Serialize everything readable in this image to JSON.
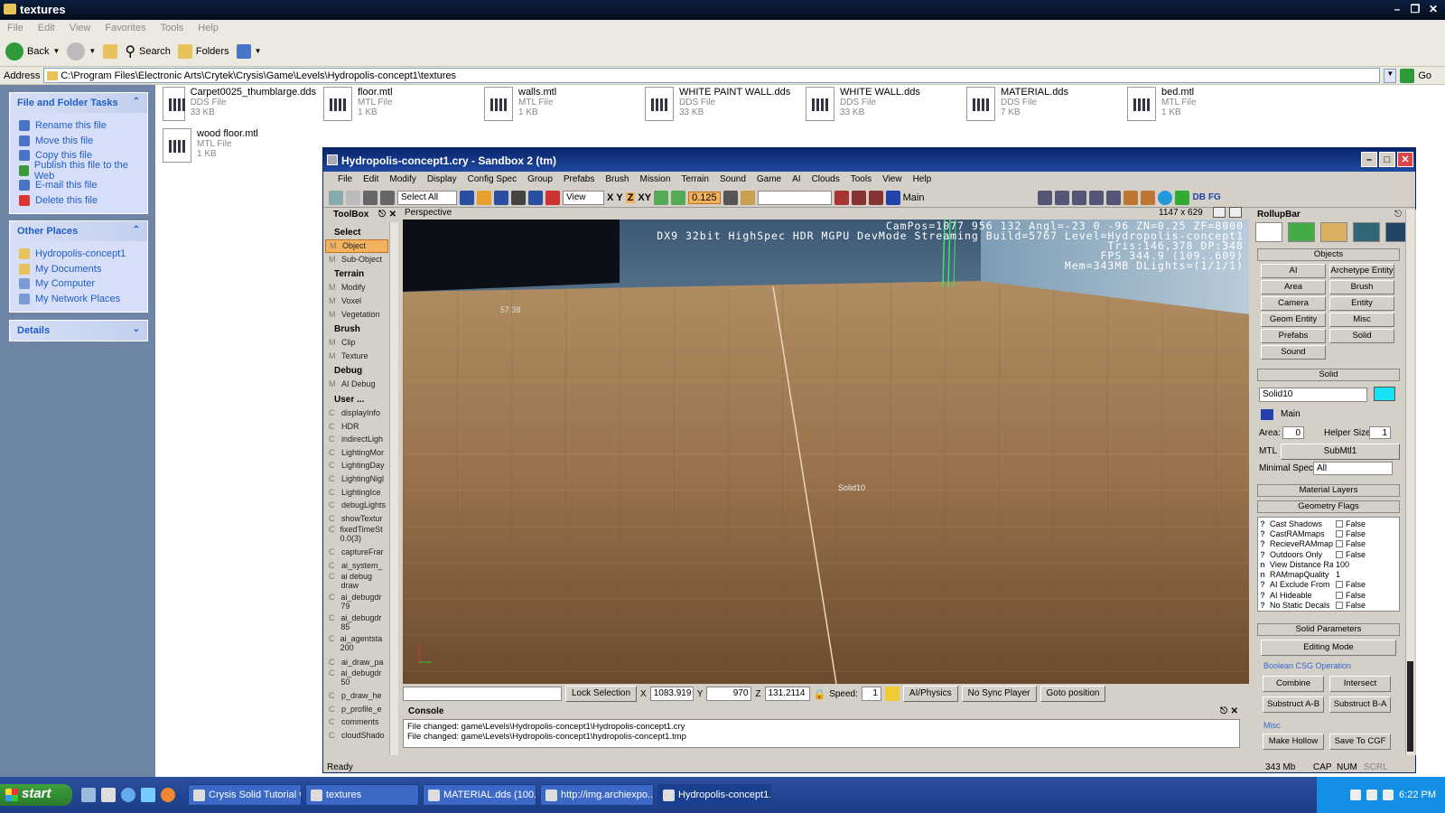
{
  "explorer": {
    "title": "textures",
    "menu": [
      "File",
      "Edit",
      "View",
      "Favorites",
      "Tools",
      "Help"
    ],
    "toolbar": {
      "back": "Back",
      "search": "Search",
      "folders": "Folders"
    },
    "address_label": "Address",
    "address": "C:\\Program Files\\Electronic Arts\\Crytek\\Crysis\\Game\\Levels\\Hydropolis-concept1\\textures",
    "go": "Go",
    "tasks_title": "File and Folder Tasks",
    "tasks": [
      "Rename this file",
      "Move this file",
      "Copy this file",
      "Publish this file to the Web",
      "E-mail this file",
      "Delete this file"
    ],
    "places_title": "Other Places",
    "places": [
      "Hydropolis-concept1",
      "My Documents",
      "My Computer",
      "My Network Places"
    ],
    "details_title": "Details",
    "files": [
      {
        "name": "Carpet0025_thumblarge.dds",
        "type": "DDS File",
        "size": "33 KB"
      },
      {
        "name": "floor.mtl",
        "type": "MTL File",
        "size": "1 KB"
      },
      {
        "name": "walls.mtl",
        "type": "MTL File",
        "size": "1 KB"
      },
      {
        "name": "WHITE PAINT WALL.dds",
        "type": "DDS File",
        "size": "33 KB"
      },
      {
        "name": "WHITE WALL.dds",
        "type": "DDS File",
        "size": "33 KB"
      },
      {
        "name": "MATERIAL.dds",
        "type": "DDS File",
        "size": "7 KB"
      },
      {
        "name": "bed.mtl",
        "type": "MTL File",
        "size": "1 KB"
      },
      {
        "name": "wood floor.mtl",
        "type": "MTL File",
        "size": "1 KB"
      }
    ]
  },
  "sandbox": {
    "title": "Hydropolis-concept1.cry - Sandbox 2 (tm)",
    "menu": [
      "File",
      "Edit",
      "Modify",
      "Display",
      "Config Spec",
      "Group",
      "Prefabs",
      "Brush",
      "Mission",
      "Terrain",
      "Sound",
      "Game",
      "AI",
      "Clouds",
      "Tools",
      "View",
      "Help"
    ],
    "toolbar": {
      "select_all": "Select All",
      "view": "View",
      "grid": "0.125",
      "layer": "Main",
      "axis_x": "X",
      "axis_y": "Y",
      "axis_z": "Z",
      "axis_xy": "XY",
      "db": "DB",
      "fg": "FG"
    },
    "toolbox": {
      "title": "ToolBox",
      "sections": [
        {
          "name": "Select",
          "items": [
            {
              "p": "M",
              "label": "Object",
              "sel": true
            },
            {
              "p": "M",
              "label": "Sub-Object"
            }
          ]
        },
        {
          "name": "Terrain",
          "items": [
            {
              "p": "M",
              "label": "Modify"
            },
            {
              "p": "M",
              "label": "Voxel"
            },
            {
              "p": "M",
              "label": "Vegetation"
            }
          ]
        },
        {
          "name": "Brush",
          "items": [
            {
              "p": "M",
              "label": "Clip"
            },
            {
              "p": "M",
              "label": "Texture"
            }
          ]
        },
        {
          "name": "Debug",
          "items": [
            {
              "p": "M",
              "label": "AI Debug"
            }
          ]
        },
        {
          "name": "User ...",
          "items": [
            {
              "p": "C",
              "label": "displayInfo"
            },
            {
              "p": "C",
              "label": "HDR"
            },
            {
              "p": "C",
              "label": "indirectLigh"
            },
            {
              "p": "C",
              "label": "LightingMor"
            },
            {
              "p": "C",
              "label": "LightingDay"
            },
            {
              "p": "C",
              "label": "LightingNigl"
            },
            {
              "p": "C",
              "label": "LightingIce"
            },
            {
              "p": "C",
              "label": "debugLights"
            },
            {
              "p": "C",
              "label": "showTextur"
            },
            {
              "p": "C",
              "label": "fixedTimeSt 0.0(3)"
            },
            {
              "p": "C",
              "label": "captureFrar"
            },
            {
              "p": "C",
              "label": "ai_system_"
            },
            {
              "p": "C",
              "label": "ai debug draw"
            },
            {
              "p": "C",
              "label": "ai_debugdr 79"
            },
            {
              "p": "C",
              "label": "ai_debugdr 85"
            },
            {
              "p": "C",
              "label": "ai_agentsta 200"
            },
            {
              "p": "C",
              "label": "ai_draw_pa"
            },
            {
              "p": "C",
              "label": "ai_debugdr 50"
            },
            {
              "p": "C",
              "label": "p_draw_he"
            },
            {
              "p": "C",
              "label": "p_profile_e"
            },
            {
              "p": "C",
              "label": "comments"
            },
            {
              "p": "C",
              "label": "cloudShado"
            }
          ]
        }
      ]
    },
    "viewport": {
      "label": "Perspective",
      "size": "1147 x 629",
      "hud": [
        "CamPos=1077 956 132 Angl=-23  0 -96 ZN=0.25 ZF=8000",
        "DX9 32bit HighSpec HDR MGPU DevMode Streaming Build=5767 Level=Hydropolis-concept1",
        "Tris:146,378  DP:348",
        "FPS 344.9 (109..609)",
        "Mem=343MB DLights=(1/1/1)"
      ],
      "marker": "57.38",
      "object_label": "Solid10"
    },
    "status": {
      "lock": "Lock Selection",
      "x_label": "X",
      "x": "1083.919",
      "y_label": "Y",
      "y": "970",
      "z_label": "Z",
      "z": "131.2114",
      "speed_label": "Speed:",
      "speed": "1",
      "ai_physics": "AI/Physics",
      "no_sync": "No Sync Player",
      "goto": "Goto position"
    },
    "console": {
      "title": "Console",
      "lines": [
        "File changed: game\\Levels\\Hydropolis-concept1\\Hydropolis-concept1.cry",
        "File changed: game\\Levels\\Hydropolis-concept1\\hydropolis-concept1.tmp"
      ]
    },
    "statusbar": {
      "ready": "Ready",
      "mem": "343 Mb",
      "cap": "CAP",
      "num": "NUM",
      "scrl": "SCRL"
    },
    "rollup": {
      "title": "RollupBar",
      "objects_head": "Objects",
      "objects": [
        "AI",
        "Archetype Entity",
        "Area",
        "Brush",
        "Camera",
        "Entity",
        "Geom Entity",
        "Misc",
        "Prefabs",
        "Solid",
        "Sound"
      ],
      "solid_head": "Solid",
      "name": "Solid10",
      "color": "#19e0f2",
      "layer": "Main",
      "area_label": "Area:",
      "area": "0",
      "helper_label": "Helper Size:",
      "helper": "1",
      "mtl_label": "MTL",
      "mtl": "SubMtl1",
      "minspec_label": "Minimal Spec:",
      "minspec": "All",
      "material_layers": "Material Layers",
      "geometry_flags": "Geometry Flags",
      "flags": [
        {
          "q": "?",
          "name": "Cast Shadows",
          "val": "False",
          "cb": true
        },
        {
          "q": "?",
          "name": "CastRAMmaps",
          "val": "False",
          "cb": true
        },
        {
          "q": "?",
          "name": "RecieveRAMmap",
          "val": "False",
          "cb": true
        },
        {
          "q": "?",
          "name": "Outdoors Only",
          "val": "False",
          "cb": true
        },
        {
          "q": "n",
          "name": "View Distance Ra",
          "val": "100",
          "cb": false
        },
        {
          "q": "n",
          "name": "RAMmapQuality",
          "val": "1",
          "cb": false
        },
        {
          "q": "?",
          "name": "AI Exclude From",
          "val": "False",
          "cb": true
        },
        {
          "q": "?",
          "name": "AI Hideable",
          "val": "False",
          "cb": true
        },
        {
          "q": "?",
          "name": "No Static Decals",
          "val": "False",
          "cb": true
        }
      ],
      "solid_params": "Solid Parameters",
      "editing_mode": "Editing Mode",
      "csg_label": "Boolean CSG Operation",
      "combine": "Combine",
      "intersect": "Intersect",
      "sub_ab": "Substruct A-B",
      "sub_ba": "Substruct B-A",
      "misc_label": "Misc",
      "make_hollow": "Make Hollow",
      "save_cgf": "Save To CGF"
    }
  },
  "taskbar": {
    "start": "start",
    "tasks": [
      "Crysis Solid Tutorial v...",
      "textures",
      "MATERIAL.dds (100...",
      "http://img.archiexpo....",
      "Hydropolis-concept1...."
    ],
    "active": 4,
    "clock": "6:22 PM"
  }
}
